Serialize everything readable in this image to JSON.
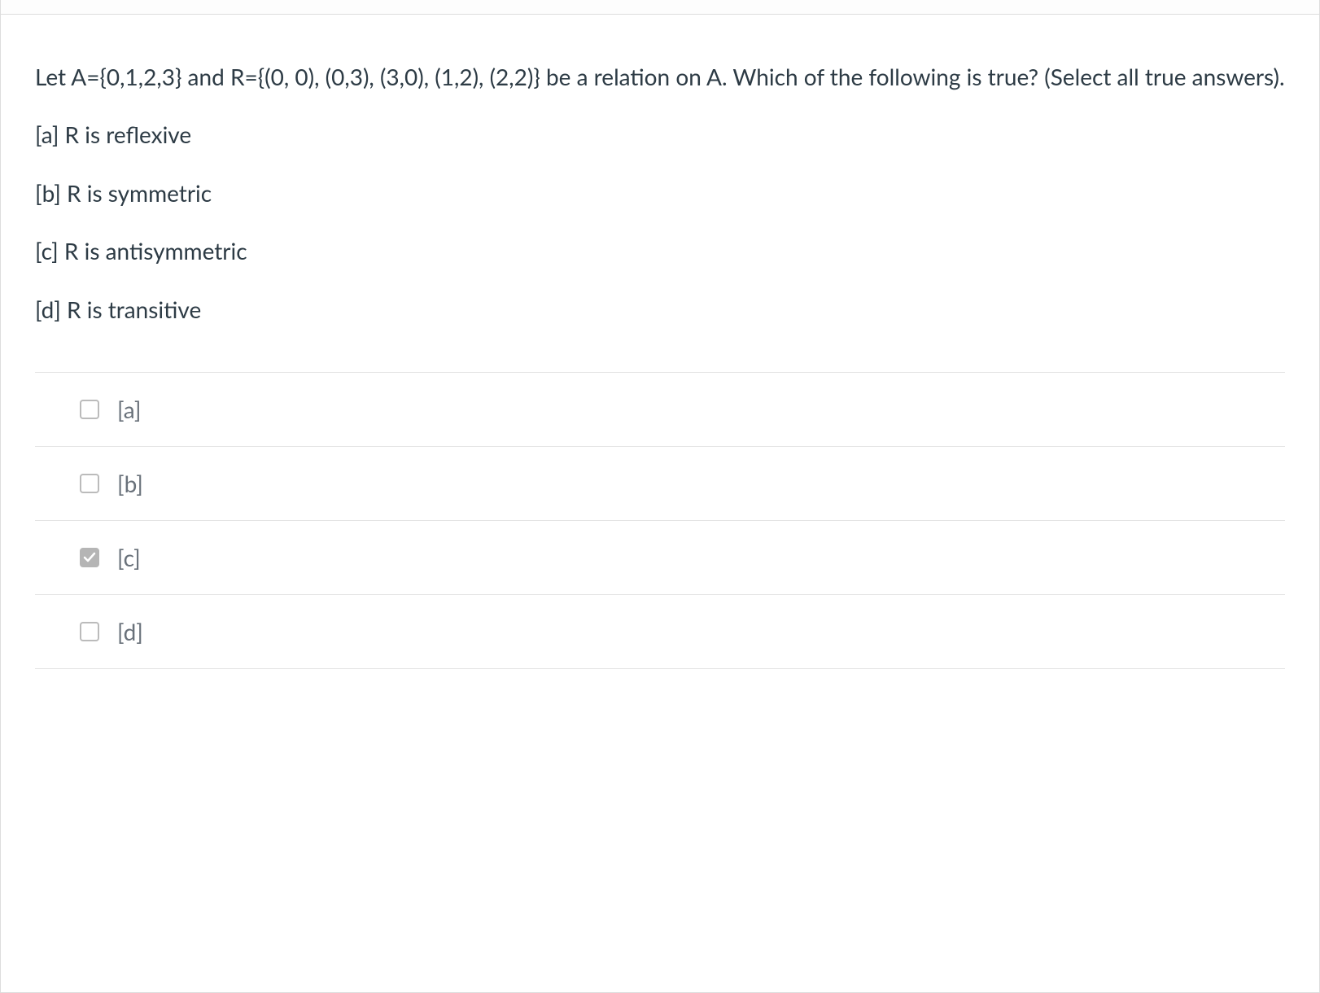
{
  "question": {
    "prompt": "Let A={0,1,2,3} and R={(0, 0), (0,3), (3,0), (1,2), (2,2)} be a relation on A. Which of the following is true? (Select all true answers).",
    "options": [
      "[a] R is reflexive",
      "[b] R is symmetric",
      "[c] R is antisymmetric",
      "[d] R is transitive"
    ]
  },
  "answers": [
    {
      "label": "[a]",
      "checked": false
    },
    {
      "label": "[b]",
      "checked": false
    },
    {
      "label": "[c]",
      "checked": true
    },
    {
      "label": "[d]",
      "checked": false
    }
  ]
}
